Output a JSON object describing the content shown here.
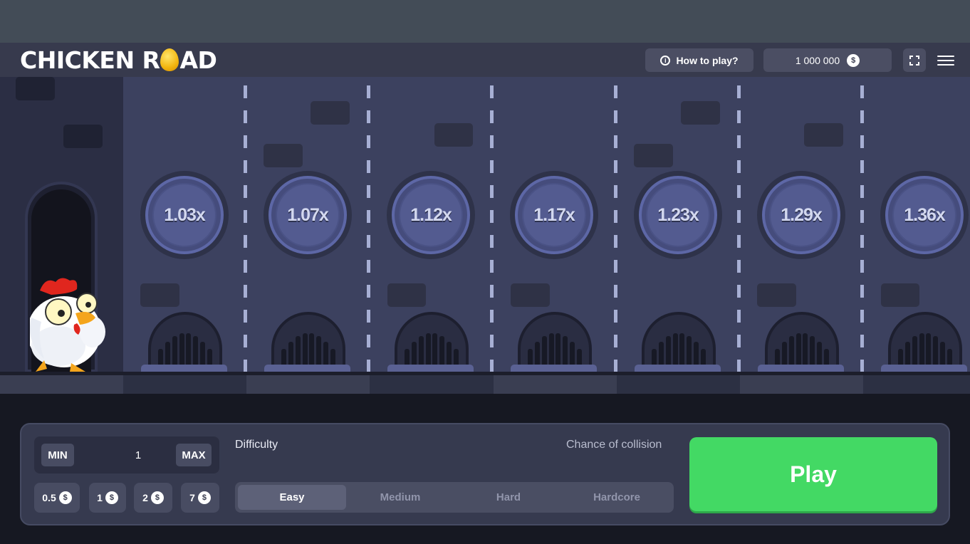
{
  "header": {
    "logo_left": "CHICKEN R",
    "logo_right": "AD",
    "how_to_play": "How to play?",
    "balance": "1 000 000",
    "currency_symbol": "$"
  },
  "game": {
    "multipliers": [
      "1.03x",
      "1.07x",
      "1.12x",
      "1.17x",
      "1.23x",
      "1.29x",
      "1.36x"
    ]
  },
  "controls": {
    "min_label": "MIN",
    "max_label": "MAX",
    "bet_value": "1",
    "quick_bets": [
      "0.5",
      "1",
      "2",
      "7"
    ],
    "currency_symbol": "$",
    "difficulty_label": "Difficulty",
    "collision_label": "Chance of collision",
    "difficulties": [
      "Easy",
      "Medium",
      "Hard",
      "Hardcore"
    ],
    "selected_difficulty": "Easy",
    "play_label": "Play"
  },
  "colors": {
    "accent_play": "#43d964",
    "lane_bg": "#3c415f",
    "panel_bg": "#363a4f"
  }
}
